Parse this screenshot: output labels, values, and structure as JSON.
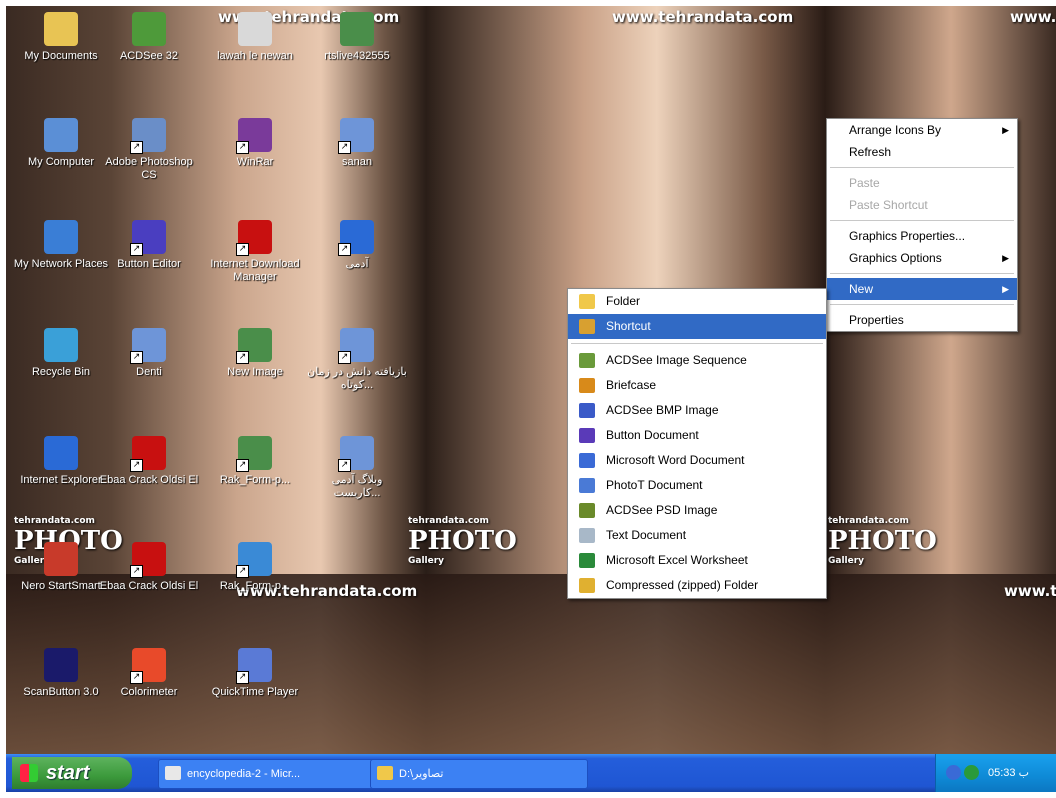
{
  "watermark": "www.tehrandata.com",
  "photo_gallery": {
    "site": "tehrandata.com",
    "logo": "PHOTO",
    "script": "Gallery"
  },
  "desktop_icons": [
    {
      "label": "My Documents",
      "color": "#e8c454"
    },
    {
      "label": "ACDSee 32",
      "color": "#4e9a3a"
    },
    {
      "label": "lawah le newan",
      "color": "#d9d9d9"
    },
    {
      "label": "rtslive432555",
      "color": "#4a8e4a"
    },
    {
      "label": "My Computer",
      "color": "#5b8fd6"
    },
    {
      "label": "Adobe Photoshop CS",
      "color": "#6a8ec8"
    },
    {
      "label": "WinRar",
      "color": "#7a3a9a"
    },
    {
      "label": "sanan",
      "color": "#6e95d8"
    },
    {
      "label": "My Network Places",
      "color": "#3a7ed6"
    },
    {
      "label": "Button Editor",
      "color": "#4a3ec0"
    },
    {
      "label": "Internet Download Manager",
      "color": "#c81010"
    },
    {
      "label": "آدمی",
      "color": "#2a6ad6"
    },
    {
      "label": "Recycle Bin",
      "color": "#3aa0d8"
    },
    {
      "label": "Denti",
      "color": "#6e95d8"
    },
    {
      "label": "New Image",
      "color": "#4a8e4a"
    },
    {
      "label": "بازیافته دانش در زمان کوتاه...",
      "color": "#6e95d8"
    },
    {
      "label": "Internet Explorer",
      "color": "#2a6ad6"
    },
    {
      "label": "Ebaa Crack Oldsi El",
      "color": "#c81010"
    },
    {
      "label": "Rak_Form-p...",
      "color": "#4a8e4a"
    },
    {
      "label": "وبلاگ آدمی کاریست...",
      "color": "#6e95d8"
    },
    {
      "label": "Nero StartSmart",
      "color": "#c83a2a"
    },
    {
      "label": "Ebaa Crack Oldsi El",
      "color": "#c81010"
    },
    {
      "label": "Rak_Form-p...",
      "color": "#3a8ad6"
    },
    {
      "label": "ScanButton 3.0",
      "color": "#1a1a6a"
    },
    {
      "label": "Colorimeter",
      "color": "#e84a2a"
    },
    {
      "label": "QuickTime Player",
      "color": "#5a7ad6"
    }
  ],
  "context_menu": {
    "items": [
      {
        "label": "Arrange Icons By",
        "submenu": true
      },
      {
        "label": "Refresh"
      },
      {
        "separator": true
      },
      {
        "label": "Paste",
        "disabled": true
      },
      {
        "label": "Paste Shortcut",
        "disabled": true
      },
      {
        "separator": true
      },
      {
        "label": "Graphics Properties..."
      },
      {
        "label": "Graphics Options",
        "submenu": true
      },
      {
        "separator": true
      },
      {
        "label": "New",
        "submenu": true,
        "selected": true
      },
      {
        "separator": true
      },
      {
        "label": "Properties"
      }
    ]
  },
  "new_submenu": {
    "items": [
      {
        "label": "Folder",
        "color": "#f0c84a"
      },
      {
        "label": "Shortcut",
        "color": "#d8a030",
        "selected": true
      },
      {
        "separator": true
      },
      {
        "label": "ACDSee Image Sequence",
        "color": "#6a9a3a"
      },
      {
        "label": "Briefcase",
        "color": "#d88a1a"
      },
      {
        "label": "ACDSee BMP Image",
        "color": "#3a5ac8"
      },
      {
        "label": "Button Document",
        "color": "#5a3ab8"
      },
      {
        "label": "Microsoft Word Document",
        "color": "#3a6ad6"
      },
      {
        "label": "PhotoT Document",
        "color": "#4a7ad6"
      },
      {
        "label": "ACDSee PSD Image",
        "color": "#6a8a2a"
      },
      {
        "label": "Text Document",
        "color": "#a8b8c8"
      },
      {
        "label": "Microsoft Excel Worksheet",
        "color": "#2a8a3a"
      },
      {
        "label": "Compressed (zipped) Folder",
        "color": "#e0b030"
      }
    ]
  },
  "taskbar": {
    "start_label": "start",
    "tasks": [
      {
        "label": "encyclopedia-2 - Micr...",
        "color": "#e8e8e8"
      },
      {
        "label": "D:\\تصاویر",
        "color": "#f0c84a"
      }
    ],
    "clock": "05:33 ب"
  },
  "colors": {
    "taskbar": "#245edb",
    "selection": "#316ac5",
    "start": "#3c9a3c"
  }
}
